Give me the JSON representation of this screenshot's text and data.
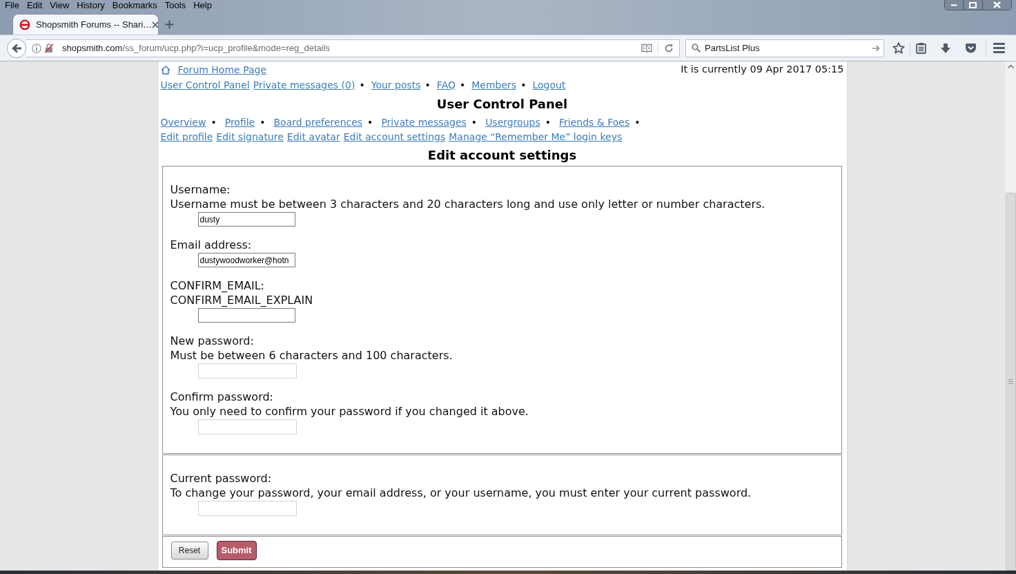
{
  "menu_bar": [
    "File",
    "Edit",
    "View",
    "History",
    "Bookmarks",
    "Tools",
    "Help"
  ],
  "tabs": [
    {
      "title": "Shopsmith Forums -- Shari…",
      "selected": true
    }
  ],
  "address_bar": {
    "host": "shopsmith.com",
    "path": "/ss_forum/ucp.php?i=ucp_profile&mode=reg_details"
  },
  "search_bar": {
    "value": "PartsList Plus"
  },
  "page": {
    "home_link": "Forum Home Page",
    "current_time": "It is currently 09 Apr 2017 05:15",
    "top_links": [
      {
        "label": "User Control Panel"
      },
      {
        "label": "Private messages (0)",
        "separator": "•"
      },
      {
        "label": "Your posts",
        "separator": "•"
      },
      {
        "label": "FAQ",
        "separator": "•"
      },
      {
        "label": "Members",
        "separator": "•"
      },
      {
        "label": "Logout"
      }
    ],
    "title": "User Control Panel",
    "panel_tabs": [
      {
        "label": "Overview",
        "separator": "•"
      },
      {
        "label": "Profile",
        "separator": "•"
      },
      {
        "label": "Board preferences",
        "separator": "•"
      },
      {
        "label": "Private messages",
        "separator": "•"
      },
      {
        "label": "Usergroups",
        "separator": "•"
      },
      {
        "label": "Friends & Foes",
        "separator": "•"
      }
    ],
    "panel_subtabs": [
      {
        "label": "Edit profile"
      },
      {
        "label": "Edit signature"
      },
      {
        "label": "Edit avatar"
      },
      {
        "label": "Edit account settings"
      },
      {
        "label": "Manage “Remember Me” login keys"
      }
    ],
    "section_title": "Edit account settings",
    "fieldsets": [
      {
        "fields": [
          {
            "label": "Username:",
            "explain": "Username must be between 3 characters and 20 characters long and use only letter or number characters.",
            "kind": "text",
            "value": "dusty"
          },
          {
            "label": "Email address:",
            "kind": "text",
            "value": "dustywoodworker@hotn"
          },
          {
            "label": "CONFIRM_EMAIL:",
            "explain": "CONFIRM_EMAIL_EXPLAIN",
            "kind": "text"
          },
          {
            "label": "New password:",
            "explain": "Must be between 6 characters and 100 characters.",
            "kind": "password"
          },
          {
            "label": "Confirm password:",
            "explain": "You only need to confirm your password if you changed it above.",
            "kind": "password"
          }
        ]
      },
      {
        "fields": [
          {
            "label": "Current password:",
            "explain": "To change your password, your email address, or your username, you must enter your current password.",
            "kind": "password"
          }
        ]
      }
    ],
    "buttons": [
      {
        "label": "Reset",
        "kind": "reset"
      },
      {
        "label": "Submit",
        "kind": "submit"
      }
    ]
  }
}
